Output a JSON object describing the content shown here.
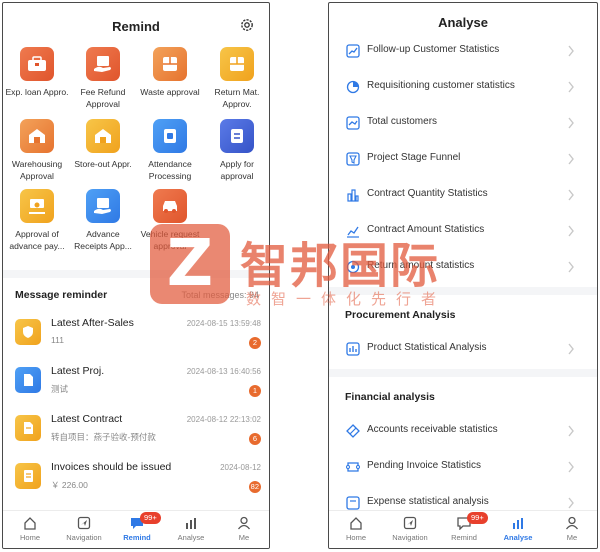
{
  "left": {
    "title": "Remind",
    "approvals": [
      {
        "label": "Exp. loan Appro.",
        "icon": "expense-loan-icon"
      },
      {
        "label": "Fee Refund Approval",
        "icon": "fee-refund-icon"
      },
      {
        "label": "Waste approval",
        "icon": "waste-icon"
      },
      {
        "label": "Return Mat. Approv.",
        "icon": "return-material-icon"
      },
      {
        "label": "Warehousing Approval",
        "icon": "warehouse-icon"
      },
      {
        "label": "Store-out Appr.",
        "icon": "store-out-icon"
      },
      {
        "label": "Attendance Processing",
        "icon": "attendance-icon"
      },
      {
        "label": "Apply for approval",
        "icon": "apply-approval-icon"
      },
      {
        "label": "Approval of advance pay...",
        "icon": "advance-payment-icon"
      },
      {
        "label": "Advance Receipts App...",
        "icon": "advance-receipts-icon"
      },
      {
        "label": "Vehicle request approval",
        "icon": "vehicle-icon"
      }
    ],
    "messages_header": "Message reminder",
    "messages_total": "Total messages: 94",
    "messages": [
      {
        "title": "Latest After-Sales",
        "sub": "111",
        "date": "2024-08-15 13:59:48",
        "count": "2"
      },
      {
        "title": "Latest Proj.",
        "sub": "测试",
        "date": "2024-08-13 16:40:56",
        "count": "1"
      },
      {
        "title": "Latest Contract",
        "sub": "转自项目：燕子验收-预付款",
        "date": "2024-08-12 22:13:02",
        "count": "6"
      },
      {
        "title": "Invoices should be issued",
        "sub": "￥ 226.00",
        "date": "2024-08-12",
        "count": "82"
      }
    ]
  },
  "right": {
    "title": "Analyse",
    "items": [
      {
        "label": "Follow-up Customer Statistics",
        "icon": "trend-chart-icon"
      },
      {
        "label": "Requisitioning customer statistics",
        "icon": "pie-chart-icon"
      },
      {
        "label": "Total customers",
        "icon": "line-chart-icon"
      },
      {
        "label": "Project Stage Funnel",
        "icon": "funnel-icon"
      },
      {
        "label": "Contract Quantity Statistics",
        "icon": "bar-chart-icon"
      },
      {
        "label": "Contract Amount Statistics",
        "icon": "area-chart-icon"
      },
      {
        "label": "Return amount statistics",
        "icon": "return-chart-icon"
      }
    ],
    "procurement_header": "Procurement Analysis",
    "procurement_items": [
      {
        "label": "Product Statistical Analysis",
        "icon": "product-chart-icon"
      }
    ],
    "financial_header": "Financial analysis",
    "financial_items": [
      {
        "label": "Accounts receivable statistics",
        "icon": "receivable-icon"
      },
      {
        "label": "Pending Invoice Statistics",
        "icon": "invoice-icon"
      },
      {
        "label": "Expense statistical analysis",
        "icon": "expense-chart-icon"
      }
    ]
  },
  "tabbar": {
    "home": "Home",
    "navigation": "Navigation",
    "remind": "Remind",
    "analyse": "Analyse",
    "me": "Me",
    "remind_badge": "99+"
  },
  "watermark": {
    "logo_letter": "Z",
    "name": "智邦国际",
    "slogan": "数智一体化先行者"
  },
  "colors": {
    "accent": "#2f79e5",
    "badge": "#e86b2e",
    "notification": "#e8402c"
  }
}
